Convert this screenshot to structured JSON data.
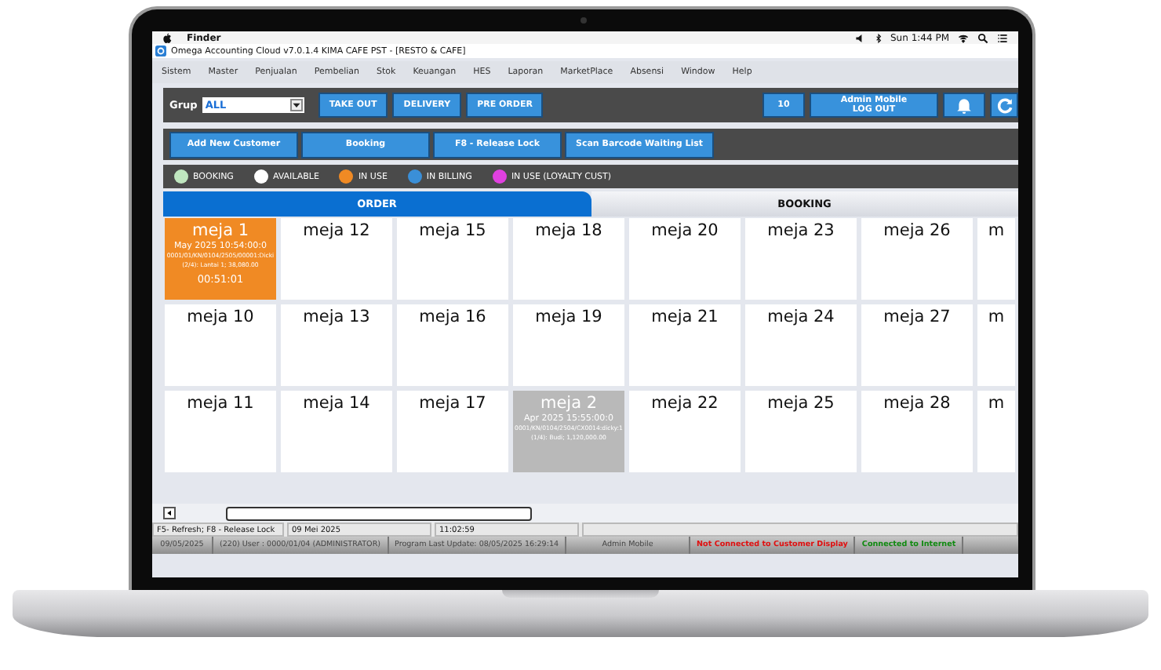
{
  "menubar": {
    "app": "Finder",
    "clock": "Sun 1:44 PM"
  },
  "window": {
    "title": "Omega Accounting Cloud v7.0.1.4 KIMA CAFE PST - [RESTO & CAFE]"
  },
  "menu": [
    "Sistem",
    "Master",
    "Penjualan",
    "Pembelian",
    "Stok",
    "Keuangan",
    "HES",
    "Laporan",
    "MarketPlace",
    "Absensi",
    "Window",
    "Help"
  ],
  "toolbar": {
    "group_label": "Grup",
    "group_value": "ALL",
    "buttons": [
      "TAKE OUT",
      "DELIVERY",
      "PRE ORDER"
    ],
    "count": "10",
    "user_name": "Admin Mobile",
    "logout": "LOG OUT"
  },
  "actions": [
    "Add New Customer",
    "Booking",
    "F8 - Release Lock",
    "Scan Barcode Waiting List"
  ],
  "legend": [
    {
      "label": "BOOKING",
      "color": "#bfe6bf"
    },
    {
      "label": "AVAILABLE",
      "color": "#ffffff"
    },
    {
      "label": "IN USE",
      "color": "#f08a24"
    },
    {
      "label": "IN BILLING",
      "color": "#3a8fd8"
    },
    {
      "label": "IN USE (LOYALTY CUST)",
      "color": "#e040e0"
    }
  ],
  "tabs": [
    {
      "label": "ORDER",
      "selected": true
    },
    {
      "label": "BOOKING",
      "selected": false
    }
  ],
  "tables": [
    [
      {
        "name": "meja 1",
        "kind": "in_use",
        "lines": [
          "May 2025 10:54:00:0",
          "0001/01/KN/0104/2505/00001:Dicki",
          "(2/4): Lantai 1; 38,080.00"
        ],
        "timer": "00:51:01"
      },
      {
        "name": "meja 12",
        "kind": "available"
      },
      {
        "name": "meja 15",
        "kind": "available"
      },
      {
        "name": "meja 18",
        "kind": "available"
      },
      {
        "name": "meja 20",
        "kind": "available"
      },
      {
        "name": "meja 23",
        "kind": "available"
      },
      {
        "name": "meja 26",
        "kind": "available"
      },
      {
        "name": "m",
        "kind": "available"
      }
    ],
    [
      {
        "name": "meja 10",
        "kind": "available"
      },
      {
        "name": "meja 13",
        "kind": "available"
      },
      {
        "name": "meja 16",
        "kind": "available"
      },
      {
        "name": "meja 19",
        "kind": "available"
      },
      {
        "name": "meja 21",
        "kind": "available"
      },
      {
        "name": "meja 24",
        "kind": "available"
      },
      {
        "name": "meja 27",
        "kind": "available"
      },
      {
        "name": "m",
        "kind": "available"
      }
    ],
    [
      {
        "name": "meja 11",
        "kind": "available"
      },
      {
        "name": "meja 14",
        "kind": "available"
      },
      {
        "name": "meja 17",
        "kind": "available"
      },
      {
        "name": "meja 2",
        "kind": "inactive",
        "lines": [
          "Apr 2025 15:55:00:0",
          "0001/KN/0104/2504/CX0014:dicky:1",
          "(1/4): Budi; 1,120,000.00"
        ]
      },
      {
        "name": "meja 22",
        "kind": "available"
      },
      {
        "name": "meja 25",
        "kind": "available"
      },
      {
        "name": "meja 28",
        "kind": "available"
      },
      {
        "name": "m",
        "kind": "available"
      }
    ]
  ],
  "status_bar": {
    "hint": "F5- Refresh; F8 - Release Lock",
    "date": "09 Mei 2025",
    "time": "11:02:59"
  },
  "footer": [
    {
      "text": "09/05/2025",
      "kind": "plain"
    },
    {
      "text": "(220) User : 0000/01/04 (ADMINISTRATOR)",
      "kind": "plain"
    },
    {
      "text": "Program Last Update: 08/05/2025 16:29:14",
      "kind": "plain"
    },
    {
      "text": "Admin Mobile",
      "kind": "plain"
    },
    {
      "text": "Not Connected to Customer Display",
      "kind": "error"
    },
    {
      "text": "Connected to Internet",
      "kind": "ok"
    }
  ]
}
